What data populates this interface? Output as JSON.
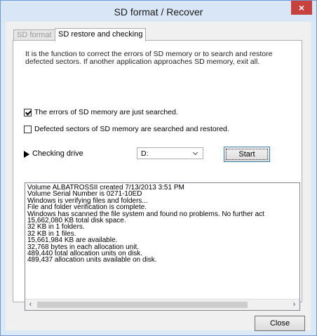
{
  "window": {
    "title": "SD format / Recover",
    "close_glyph": "×"
  },
  "tabs": [
    {
      "label": "SD format",
      "active": false
    },
    {
      "label": "SD restore and checking",
      "active": true
    }
  ],
  "description_lines": [
    "It is the function to correct the errors of SD memory or to search and restore",
    "defected sectors.  If another application approaches SD memory, exit all."
  ],
  "options": {
    "search_only": {
      "label": "The errors of SD memory are just searched.",
      "checked": true
    },
    "restore": {
      "label": "Defected sectors of SD memory are searched and restored.",
      "checked": false
    }
  },
  "drive": {
    "label": "Checking drive",
    "selected": "D:"
  },
  "buttons": {
    "start": "Start",
    "close": "Close"
  },
  "log_lines": [
    "Volume ALBATROSSII created 7/13/2013 3:51 PM",
    "Volume Serial Number is 0271-10ED",
    "Windows is verifying files and folders...",
    "File and folder verification is complete.",
    "Windows has scanned the file system and found no problems.  No further act",
    "15,662,080 KB total disk space.",
    "32 KB in 1 folders.",
    "32 KB in 1 files.",
    "15,661,984 KB are available.",
    "32,768 bytes in each allocation unit.",
    "489,440 total allocation units on disk.",
    "489,437 allocation units available on disk."
  ],
  "icons": {
    "window_close": "close-icon",
    "drive_arrow": "play-arrow-icon",
    "select_chevron": "chevron-down-icon",
    "scroll_left": "chevron-left-icon",
    "scroll_right": "chevron-right-icon"
  },
  "colors": {
    "titlebar": "#d8e6f5",
    "close_button": "#c7413f",
    "window_border": "#6d9ad6"
  }
}
